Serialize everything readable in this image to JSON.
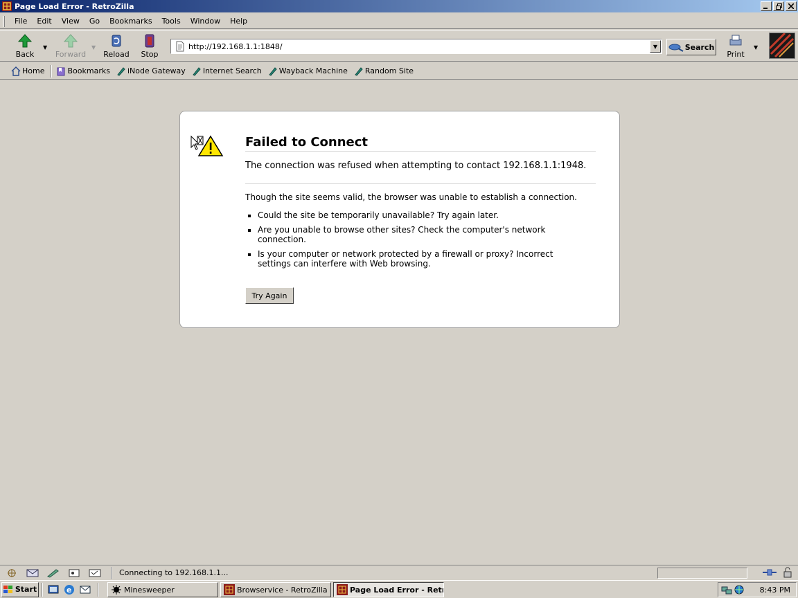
{
  "window": {
    "title": "Page Load Error - RetroZilla"
  },
  "menu": [
    "File",
    "Edit",
    "View",
    "Go",
    "Bookmarks",
    "Tools",
    "Window",
    "Help"
  ],
  "nav": {
    "back": "Back",
    "forward": "Forward",
    "reload": "Reload",
    "stop": "Stop",
    "url": "http://192.168.1.1:1848/",
    "search": "Search",
    "print": "Print"
  },
  "bookmarks": {
    "home": "Home",
    "bookmarks": "Bookmarks",
    "items": [
      "iNode Gateway",
      "Internet Search",
      "Wayback Machine",
      "Random Site"
    ]
  },
  "error": {
    "title": "Failed to Connect",
    "short_desc": "The connection was refused when attempting to contact 192.168.1.1:1948.",
    "long_desc": "Though the site seems valid, the browser was unable to establish a connection.",
    "bullets": [
      "Could the site be temporarily unavailable? Try again later.",
      "Are you unable to browse other sites? Check the computer's network connection.",
      "Is your computer or network protected by a firewall or proxy? Incorrect settings can interfere with Web browsing."
    ],
    "button": "Try Again"
  },
  "status": {
    "text": "Connecting to 192.168.1.1..."
  },
  "taskbar": {
    "start": "Start",
    "tasks": [
      "Minesweeper",
      "Browservice - RetroZilla",
      "Page Load Error - Retr..."
    ],
    "clock": "8:43 PM"
  },
  "colors": {
    "titlebar_start": "#0a246a",
    "titlebar_end": "#a6caf0",
    "chrome": "#d4d0c8",
    "warning_yellow": "#ffe600"
  }
}
